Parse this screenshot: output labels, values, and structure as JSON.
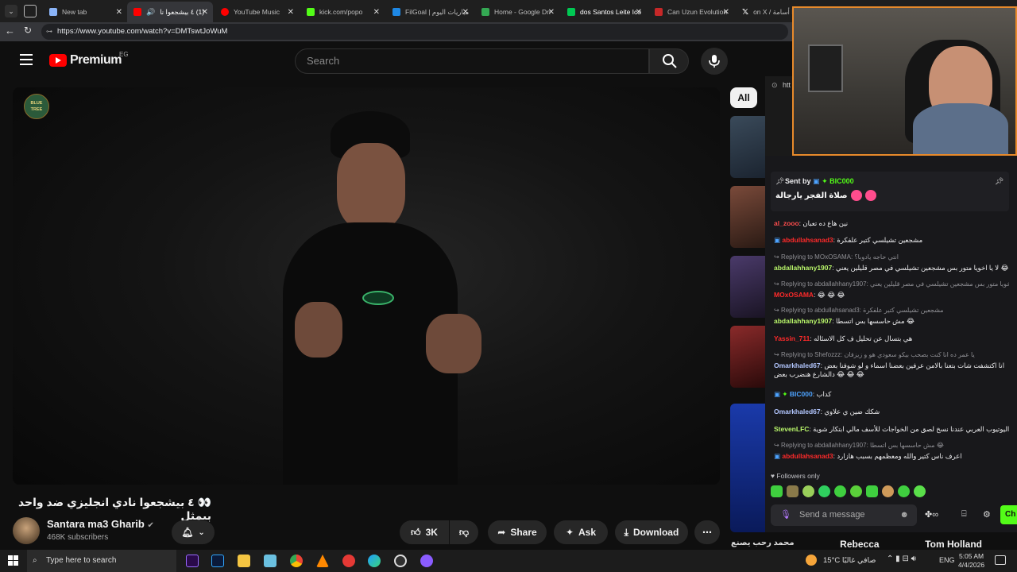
{
  "browser": {
    "tabs": [
      {
        "label": "New tab",
        "color": "#8ab4f8"
      },
      {
        "label": "(1) ٤ بيشجعوا نا",
        "color": "#ff0000",
        "active": true
      },
      {
        "label": "YouTube Music",
        "color": "#ff0000"
      },
      {
        "label": "kick.com/popo",
        "color": "#53fc18"
      },
      {
        "label": "FilGoal | مباريات اليوم",
        "color": "#1e88e5"
      },
      {
        "label": "Home - Google Dri",
        "color": "#34a853"
      },
      {
        "label": "dos Santos Leite Ico",
        "color": "#00c853"
      },
      {
        "label": "Can Uzun Evolution",
        "color": "#c62828"
      },
      {
        "label": "on X / عزا أسامة",
        "color": "#ffffff"
      }
    ],
    "url": "https://www.youtube.com/watch?v=DMTswtJoWuM"
  },
  "youtube": {
    "logo_text": "Premium",
    "country_code": "EG",
    "search_placeholder": "Search",
    "chip_all": "All",
    "video_title": "👀 ٤ بيشجعوا نادي انجليزي ضد واحد بيمثل",
    "channel_name": "Santara ma3 Gharib",
    "subscribers": "468K subscribers",
    "like_count": "3K",
    "share_label": "Share",
    "ask_label": "Ask",
    "download_label": "Download",
    "watermark": "BLUE TREE",
    "bottom_names": [
      "محمد رحب يصنع",
      "Rebecca",
      "Tom Holland"
    ]
  },
  "stream": {
    "pinned": {
      "sent_by_label": "Sent by",
      "user": "BIC000",
      "message": "صلاة الفجر يارجالة"
    },
    "partial_url": "htt",
    "messages": [
      {
        "user": "al_zooo",
        "color": "#ff4d4d",
        "text": "نين هاع ده تعبان"
      },
      {
        "user": "abdullahsanad3",
        "color": "#ff2a2a",
        "text": "مشجعين تشيلسي كتير علفكرة"
      },
      {
        "reply": "Replying to MOxOSAMA: انتي حاجه يادوبا؟"
      },
      {
        "user": "abdallahhany1907",
        "color": "#b8f56a",
        "text": "لا يا اخويا متور بس مشجعين تشيلسي في مصر قليلين يعني 😂"
      },
      {
        "reply": "Replying to abdallahhany1907: يا اخويا متور بس مشجعين تشيلسي في مصر قليلين يعني"
      },
      {
        "user": "MOxOSAMA",
        "color": "#ff2a2a",
        "text": "😂 😂 😂"
      },
      {
        "reply": "Replying to abdullahsanad3: مشجعين تشيلسي كتير علفكرة"
      },
      {
        "user": "abdallahhany1907",
        "color": "#b8f56a",
        "text": "مش حاسسها بس اتسطا 😂"
      },
      {
        "user": "Yassin_711",
        "color": "#ff2a2a",
        "text": "هي بتسال عن تحليل ف كل الاسئاله"
      },
      {
        "reply": "Replying to Shefozzz: يا عمر ده انا كنت بصحب بيكو سعودي هو و زيزفان"
      },
      {
        "user": "Omarkhaled67",
        "color": "#b3c7ff",
        "text": "انا اكتشفت شات بتعنا بالامن عرفين بعضنا اسماء و لو شوفنا بعض 😂 😂 😂 دالشارع هنضرب بعض"
      },
      {
        "user": "BIC000",
        "color": "#4da3ff",
        "text": "كداب"
      },
      {
        "user": "Omarkhaled67",
        "color": "#b3c7ff",
        "text": "شكك ضين ي علاوي"
      },
      {
        "user": "StevenLFC",
        "color": "#b8f56a",
        "text": "اليوتيوب العربي عندنا نسخ لصق من الخواجات للأسف مالي ابتكار شوية"
      },
      {
        "reply": "Replying to abdallahhany1907: مش حاسسها بس اتسطا 😂"
      },
      {
        "user": "abdullahsanad3",
        "color": "#ff2a2a",
        "text": "اعرف ناس كتير والله ومعظمهم بسبب هازارد"
      }
    ],
    "followers_only": "Followers only",
    "send_placeholder": "Send a message",
    "chat_button": "Ch"
  },
  "taskbar": {
    "search_placeholder": "Type here to search",
    "weather": "15°C  صافي غالبًا",
    "language": "ENG",
    "time": "5:05 AM",
    "date": "4/4/2026"
  }
}
